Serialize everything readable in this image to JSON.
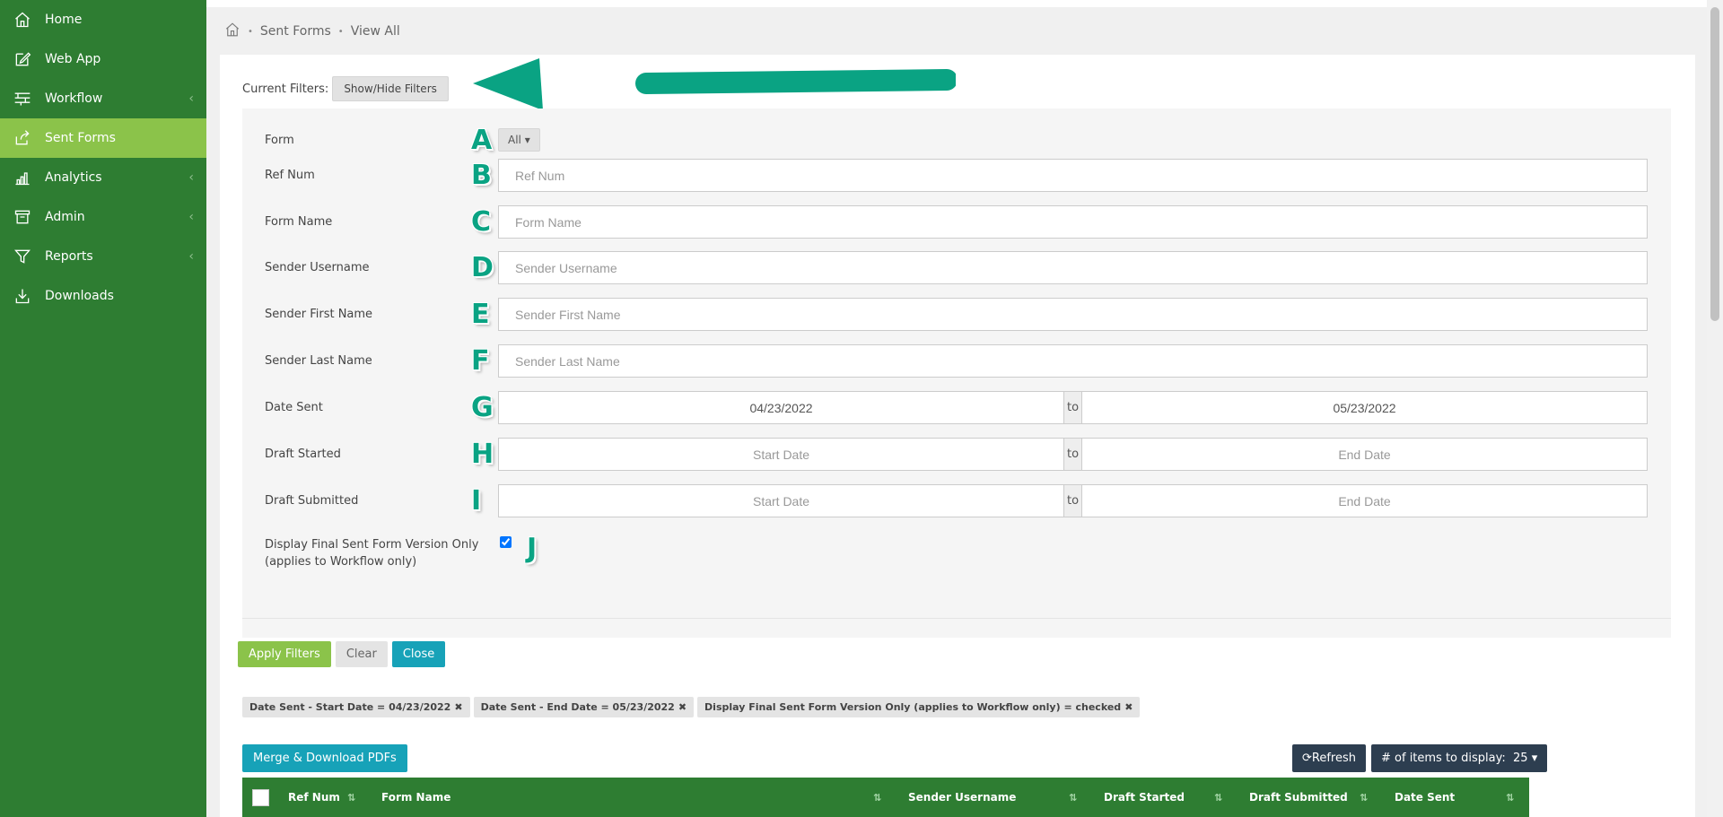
{
  "sidebar": {
    "items": [
      {
        "label": "Home",
        "icon": "home-icon"
      },
      {
        "label": "Web App",
        "icon": "edit-icon"
      },
      {
        "label": "Workflow",
        "icon": "workflow-icon",
        "caret": "‹"
      },
      {
        "label": "Sent Forms",
        "icon": "share-icon",
        "active": true
      },
      {
        "label": "Analytics",
        "icon": "bar-chart-icon",
        "caret": "‹"
      },
      {
        "label": "Admin",
        "icon": "archive-icon",
        "caret": "‹"
      },
      {
        "label": "Reports",
        "icon": "filter-icon",
        "caret": "‹"
      },
      {
        "label": "Downloads",
        "icon": "download-icon"
      }
    ]
  },
  "breadcrumb": {
    "items": [
      "Sent Forms",
      "View All"
    ],
    "sep": "•"
  },
  "filters": {
    "current_label": "Current Filters:",
    "toggle_label": "Show/Hide Filters",
    "form": {
      "label": "Form",
      "value": "All",
      "letter": "A"
    },
    "ref_num": {
      "label": "Ref Num",
      "placeholder": "Ref Num",
      "letter": "B"
    },
    "form_name": {
      "label": "Form Name",
      "placeholder": "Form Name",
      "letter": "C"
    },
    "sender_username": {
      "label": "Sender Username",
      "placeholder": "Sender Username",
      "letter": "D"
    },
    "sender_first": {
      "label": "Sender First Name",
      "placeholder": "Sender First Name",
      "letter": "E"
    },
    "sender_last": {
      "label": "Sender Last Name",
      "placeholder": "Sender Last Name",
      "letter": "F"
    },
    "date_sent": {
      "label": "Date Sent",
      "start": "04/23/2022",
      "to": "to",
      "end": "05/23/2022",
      "letter": "G"
    },
    "draft_started": {
      "label": "Draft Started",
      "start": "Start Date",
      "to": "to",
      "end": "End Date",
      "letter": "H"
    },
    "draft_submitted": {
      "label": "Draft Submitted",
      "start": "Start Date",
      "to": "to",
      "end": "End Date",
      "letter": "I"
    },
    "final_version": {
      "label_line1": "Display Final Sent Form Version Only",
      "label_line2": "(applies to Workflow only)",
      "checked": true,
      "letter": "J"
    },
    "apply_label": "Apply Filters",
    "clear_label": "Clear",
    "close_label": "Close"
  },
  "chips": [
    "Date Sent - Start Date = 04/23/2022",
    "Date Sent - End Date = 05/23/2022",
    "Display Final Sent Form Version Only (applies to Workflow only) = checked"
  ],
  "toolbar": {
    "merge_label": "Merge & Download PDFs",
    "refresh_label": "Refresh",
    "items_label": "# of items to display:",
    "items_value": "25"
  },
  "table": {
    "columns": [
      "Ref Num",
      "Form Name",
      "Sender Username",
      "Draft Started",
      "Draft Submitted",
      "Date Sent"
    ]
  },
  "colors": {
    "sidebar": "#2e7d32",
    "active": "#8bc34a",
    "teal": "#17a2b8",
    "arrow": "#0aa383",
    "dark": "#2d3e50"
  }
}
